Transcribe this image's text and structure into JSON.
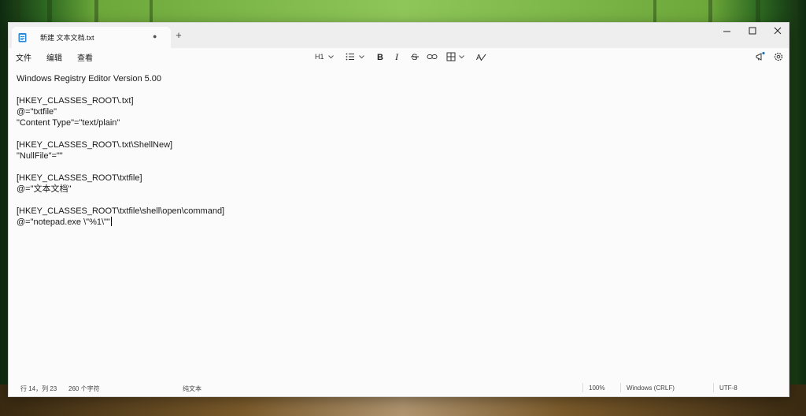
{
  "tab": {
    "title": "新建 文本文档.txt",
    "modified_dot": "●",
    "new_tab": "+"
  },
  "menu": {
    "file": "文件",
    "edit": "编辑",
    "view": "查看"
  },
  "toolbar": {
    "heading": "H1"
  },
  "editor": {
    "lines": [
      "Windows Registry Editor Version 5.00",
      "",
      "[HKEY_CLASSES_ROOT\\.txt]",
      "@=\"txtfile\"",
      "\"Content Type\"=\"text/plain\"",
      "",
      "[HKEY_CLASSES_ROOT\\.txt\\ShellNew]",
      "\"NullFile\"=\"\"",
      "",
      "[HKEY_CLASSES_ROOT\\txtfile]",
      "@=\"文本文档\"",
      "",
      "[HKEY_CLASSES_ROOT\\txtfile\\shell\\open\\command]",
      "@=\"notepad.exe \\\"%1\\\"\""
    ]
  },
  "status": {
    "position": "行 14，列 23",
    "char_count": "260 个字符",
    "format": "纯文本",
    "zoom": "100%",
    "line_ending": "Windows (CRLF)",
    "encoding": "UTF-8"
  },
  "colors": {
    "accent": "#1a73b8",
    "window_bg": "#fbfbfb",
    "titlebar_bg": "#eeeeee"
  }
}
